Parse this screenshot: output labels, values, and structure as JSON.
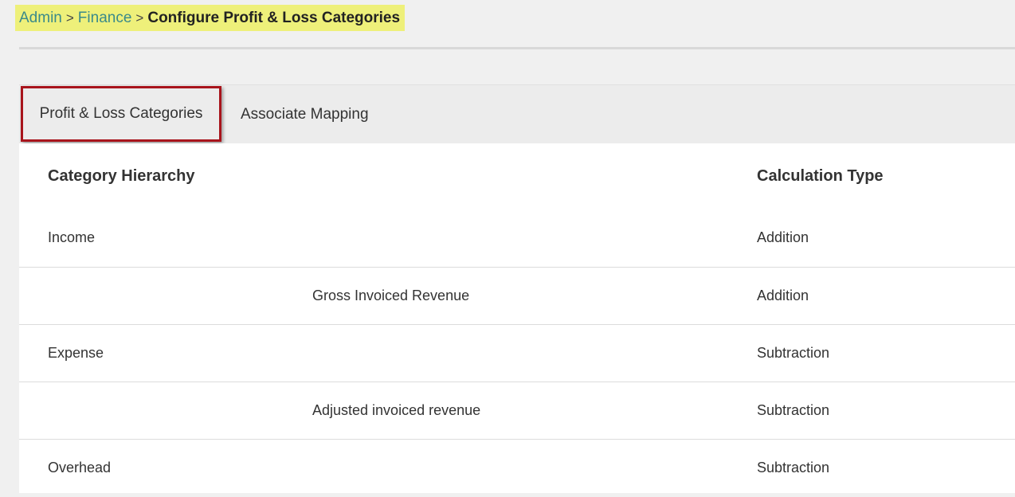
{
  "breadcrumb": {
    "items": [
      "Admin",
      "Finance"
    ],
    "separator": ">",
    "current": "Configure Profit & Loss Categories"
  },
  "tabs": [
    {
      "label": "Profit & Loss Categories",
      "active": true
    },
    {
      "label": "Associate Mapping",
      "active": false
    }
  ],
  "table": {
    "headers": [
      "Category Hierarchy",
      "Calculation Type"
    ],
    "rows": [
      {
        "category": "Income",
        "level": 0,
        "calculation": "Addition"
      },
      {
        "category": "Gross Invoiced Revenue",
        "level": 1,
        "calculation": "Addition"
      },
      {
        "category": "Expense",
        "level": 0,
        "calculation": "Subtraction"
      },
      {
        "category": "Adjusted invoiced revenue",
        "level": 1,
        "calculation": "Subtraction"
      },
      {
        "category": "Overhead",
        "level": 0,
        "calculation": "Subtraction"
      }
    ]
  },
  "colors": {
    "breadcrumb_highlight": "#eef07a",
    "link": "#3a8a8a",
    "active_tab_border": "#a8141c"
  }
}
